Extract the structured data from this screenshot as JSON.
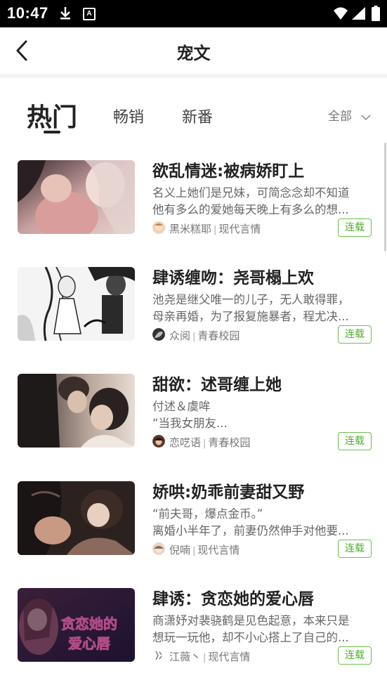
{
  "status_bar": {
    "time": "10:47",
    "icons": [
      "download-icon",
      "a-notification-icon",
      "wifi-icon",
      "signal-icon",
      "battery-icon"
    ]
  },
  "header": {
    "title": "宠文",
    "back_icon": "chevron-left-icon"
  },
  "tabs": [
    {
      "label": "热门",
      "active": true
    },
    {
      "label": "畅销",
      "active": false
    },
    {
      "label": "新番",
      "active": false
    }
  ],
  "filter": {
    "label": "全部",
    "icon": "chevron-down-icon"
  },
  "books": [
    {
      "title": "欲乱情迷:被病娇盯上",
      "desc_line1": "名义上她们是兄妹，可简念念却不知道",
      "desc_line2": "他有多么的爱她每天晚上有多么的想...",
      "author": "黑米糕耶",
      "category": "现代言情",
      "status": "连载"
    },
    {
      "title": "肆诱缠吻：尧哥榻上欢",
      "desc_line1": "池尧是继父唯一的儿子，无人敢得罪，",
      "desc_line2": "母亲再婚，为了报复施暴者，程尤决...",
      "author": "众阅",
      "category": "青春校园",
      "status": "连载"
    },
    {
      "title": "甜欲：述哥缠上她",
      "desc_line1": "付述＆虞哞",
      "desc_line2": "“当我女朋友...",
      "author": "恋呓语",
      "category": "青春校园",
      "status": "连载"
    },
    {
      "title": "娇哄:奶乖前妻甜又野",
      "desc_line1": "“前夫哥，爆点金币。”",
      "desc_line2": "离婚小半年了，前妻仍然伸手对他要...",
      "author": "倪喃",
      "category": "现代言情",
      "status": "连载"
    },
    {
      "title": "肆诱：贪恋她的爱心唇",
      "desc_line1": "商潇妤对裴骁鹤是见色起意，本来只是",
      "desc_line2": "想玩一玩他，却不小心搭上了自己的...",
      "author": "江薇丶",
      "category": "现代言情",
      "status": "连载",
      "cover_text": "贪恋她的爱心唇"
    }
  ],
  "colors": {
    "accent_green": "#4caf2b",
    "status_bar": "#000000",
    "title_text": "#222222",
    "secondary_text": "#666666"
  }
}
